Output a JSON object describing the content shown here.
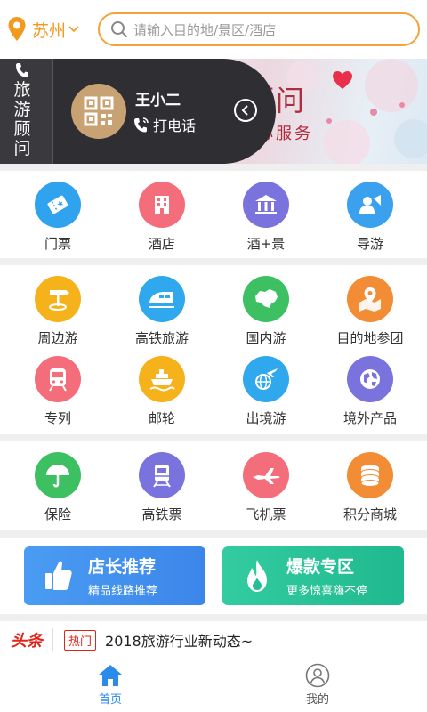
{
  "header": {
    "city": "苏州",
    "search_placeholder": "请输入目的地/景区/酒店"
  },
  "banner": {
    "advisor_label": "旅游顾问",
    "advisor_name": "王小二",
    "call_label": "打电话",
    "title": "专属旅游顾问",
    "slogan": "全年贴心服务"
  },
  "grid1": [
    {
      "label": "门票",
      "icon": "ticket-icon",
      "color": "#2fa3ee"
    },
    {
      "label": "酒店",
      "icon": "hotel-icon",
      "color": "#f36d7a"
    },
    {
      "label": "酒+景",
      "icon": "temple-icon",
      "color": "#7a72dd"
    },
    {
      "label": "导游",
      "icon": "guide-icon",
      "color": "#3ba0ee"
    }
  ],
  "grid2": [
    {
      "label": "周边游",
      "icon": "signpost-icon",
      "color": "#f6b21a"
    },
    {
      "label": "高铁旅游",
      "icon": "train-icon",
      "color": "#2fa8ee"
    },
    {
      "label": "国内游",
      "icon": "china-map-icon",
      "color": "#3cc061"
    },
    {
      "label": "目的地参团",
      "icon": "map-pin-icon",
      "color": "#f28c35"
    },
    {
      "label": "专列",
      "icon": "metro-icon",
      "color": "#f36d7a"
    },
    {
      "label": "邮轮",
      "icon": "cruise-icon",
      "color": "#f6b21a"
    },
    {
      "label": "出境游",
      "icon": "plane-globe-icon",
      "color": "#2fa8ee"
    },
    {
      "label": "境外产品",
      "icon": "globe-icon",
      "color": "#7a72dd"
    }
  ],
  "grid3": [
    {
      "label": "保险",
      "icon": "umbrella-icon",
      "color": "#3cc061"
    },
    {
      "label": "高铁票",
      "icon": "train-ticket-icon",
      "color": "#7a72dd"
    },
    {
      "label": "飞机票",
      "icon": "airplane-icon",
      "color": "#f36d7a"
    },
    {
      "label": "积分商城",
      "icon": "coins-icon",
      "color": "#f28c35"
    }
  ],
  "promos": {
    "left_title": "店长推荐",
    "left_sub": "精品线路推荐",
    "right_title": "爆款专区",
    "right_sub": "更多惊喜嗨不停"
  },
  "news": {
    "logo": "头条",
    "badge": "热门",
    "text": "2018旅游行业新动态~"
  },
  "nav": {
    "home": "首页",
    "mine": "我的",
    "active_color": "#2a8be8"
  }
}
